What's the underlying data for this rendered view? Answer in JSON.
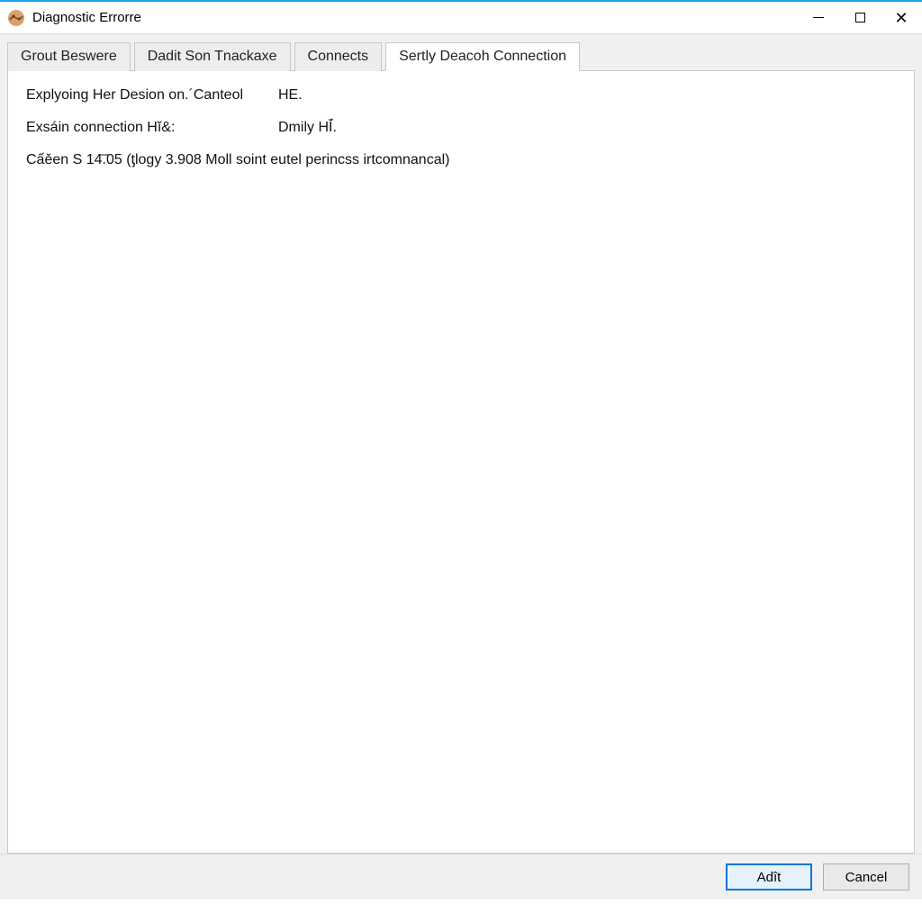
{
  "window": {
    "title": "Diagnostic Errorre"
  },
  "tabs": [
    {
      "label": "Grout Beswere"
    },
    {
      "label": "Dadit Son Tnackaxe"
    },
    {
      "label": "Connects"
    },
    {
      "label": "Sertly Deacoh Connection"
    }
  ],
  "panel": {
    "row1_label": "Explyoing Her Desion on.´Canteol",
    "row1_value": "HE.",
    "row2_label": "Exsáin connection Hĭ&:",
    "row2_value": "Dmily HĬ́.",
    "status_line": "Cấěen S 14̄.̄05 (ƫlogy 3.908 Moll soint eutel perincss irtcomnancal)"
  },
  "buttons": {
    "primary": "Adît",
    "cancel": "Cancel"
  }
}
